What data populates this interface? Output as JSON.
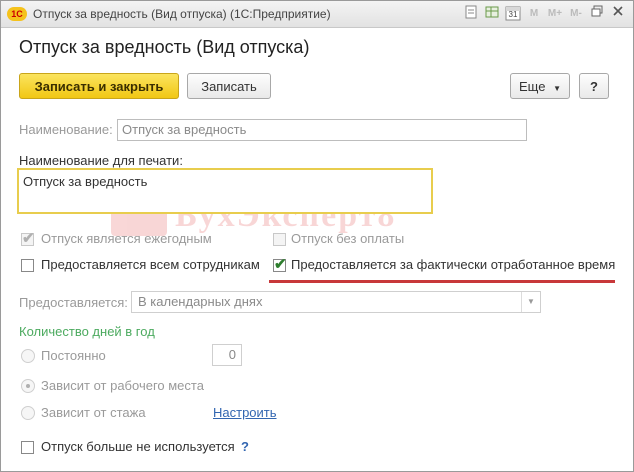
{
  "window": {
    "logo": "1С",
    "title": "Отпуск за вредность (Вид отпуска)  (1С:Предприятие)",
    "toolbar_icons": [
      "document-icon",
      "grid-icon",
      "calendar-icon",
      "m-icon",
      "m-plus-icon",
      "m-minus-icon",
      "restore-icon",
      "close-icon"
    ],
    "calendar_day": "31",
    "m_labels": [
      "M",
      "M+",
      "M-"
    ]
  },
  "heading": "Отпуск за вредность (Вид отпуска)",
  "toolbar": {
    "save_close_label": "Записать и закрыть",
    "save_label": "Записать",
    "more_label": "Еще",
    "help_label": "?"
  },
  "form": {
    "name_label": "Наименование:",
    "name_value": "Отпуск за вредность",
    "print_name_label": "Наименование для печати:",
    "print_name_value": "Отпуск за вредность",
    "cb_annual": {
      "label": "Отпуск является ежегодным",
      "checked": true,
      "disabled": true
    },
    "cb_unpaid": {
      "label": "Отпуск без оплаты",
      "checked": false,
      "disabled": true
    },
    "cb_all_staff": {
      "label": "Предоставляется всем сотрудникам",
      "checked": false
    },
    "cb_actual_time": {
      "label": "Предоставляется за фактически отработанное время",
      "checked": true
    },
    "provided_label": "Предоставляется:",
    "provided_value": "В календарных днях",
    "days_section_label": "Количество дней в год",
    "radio_constant": "Постоянно",
    "days_value": "0",
    "radio_workplace": "Зависит от рабочего места",
    "radio_tenure": "Зависит от стажа",
    "configure_link": "Настроить",
    "cb_not_used": {
      "label": "Отпуск больше не используется",
      "checked": false
    },
    "not_used_help": "?"
  },
  "watermark_text": "БухЭксперт8",
  "colors": {
    "primary_button": "#f1c714",
    "highlight_underline": "#c8383a",
    "section_label": "#4caa5f",
    "link": "#3266b1",
    "focus_border": "#e8cd4d"
  }
}
